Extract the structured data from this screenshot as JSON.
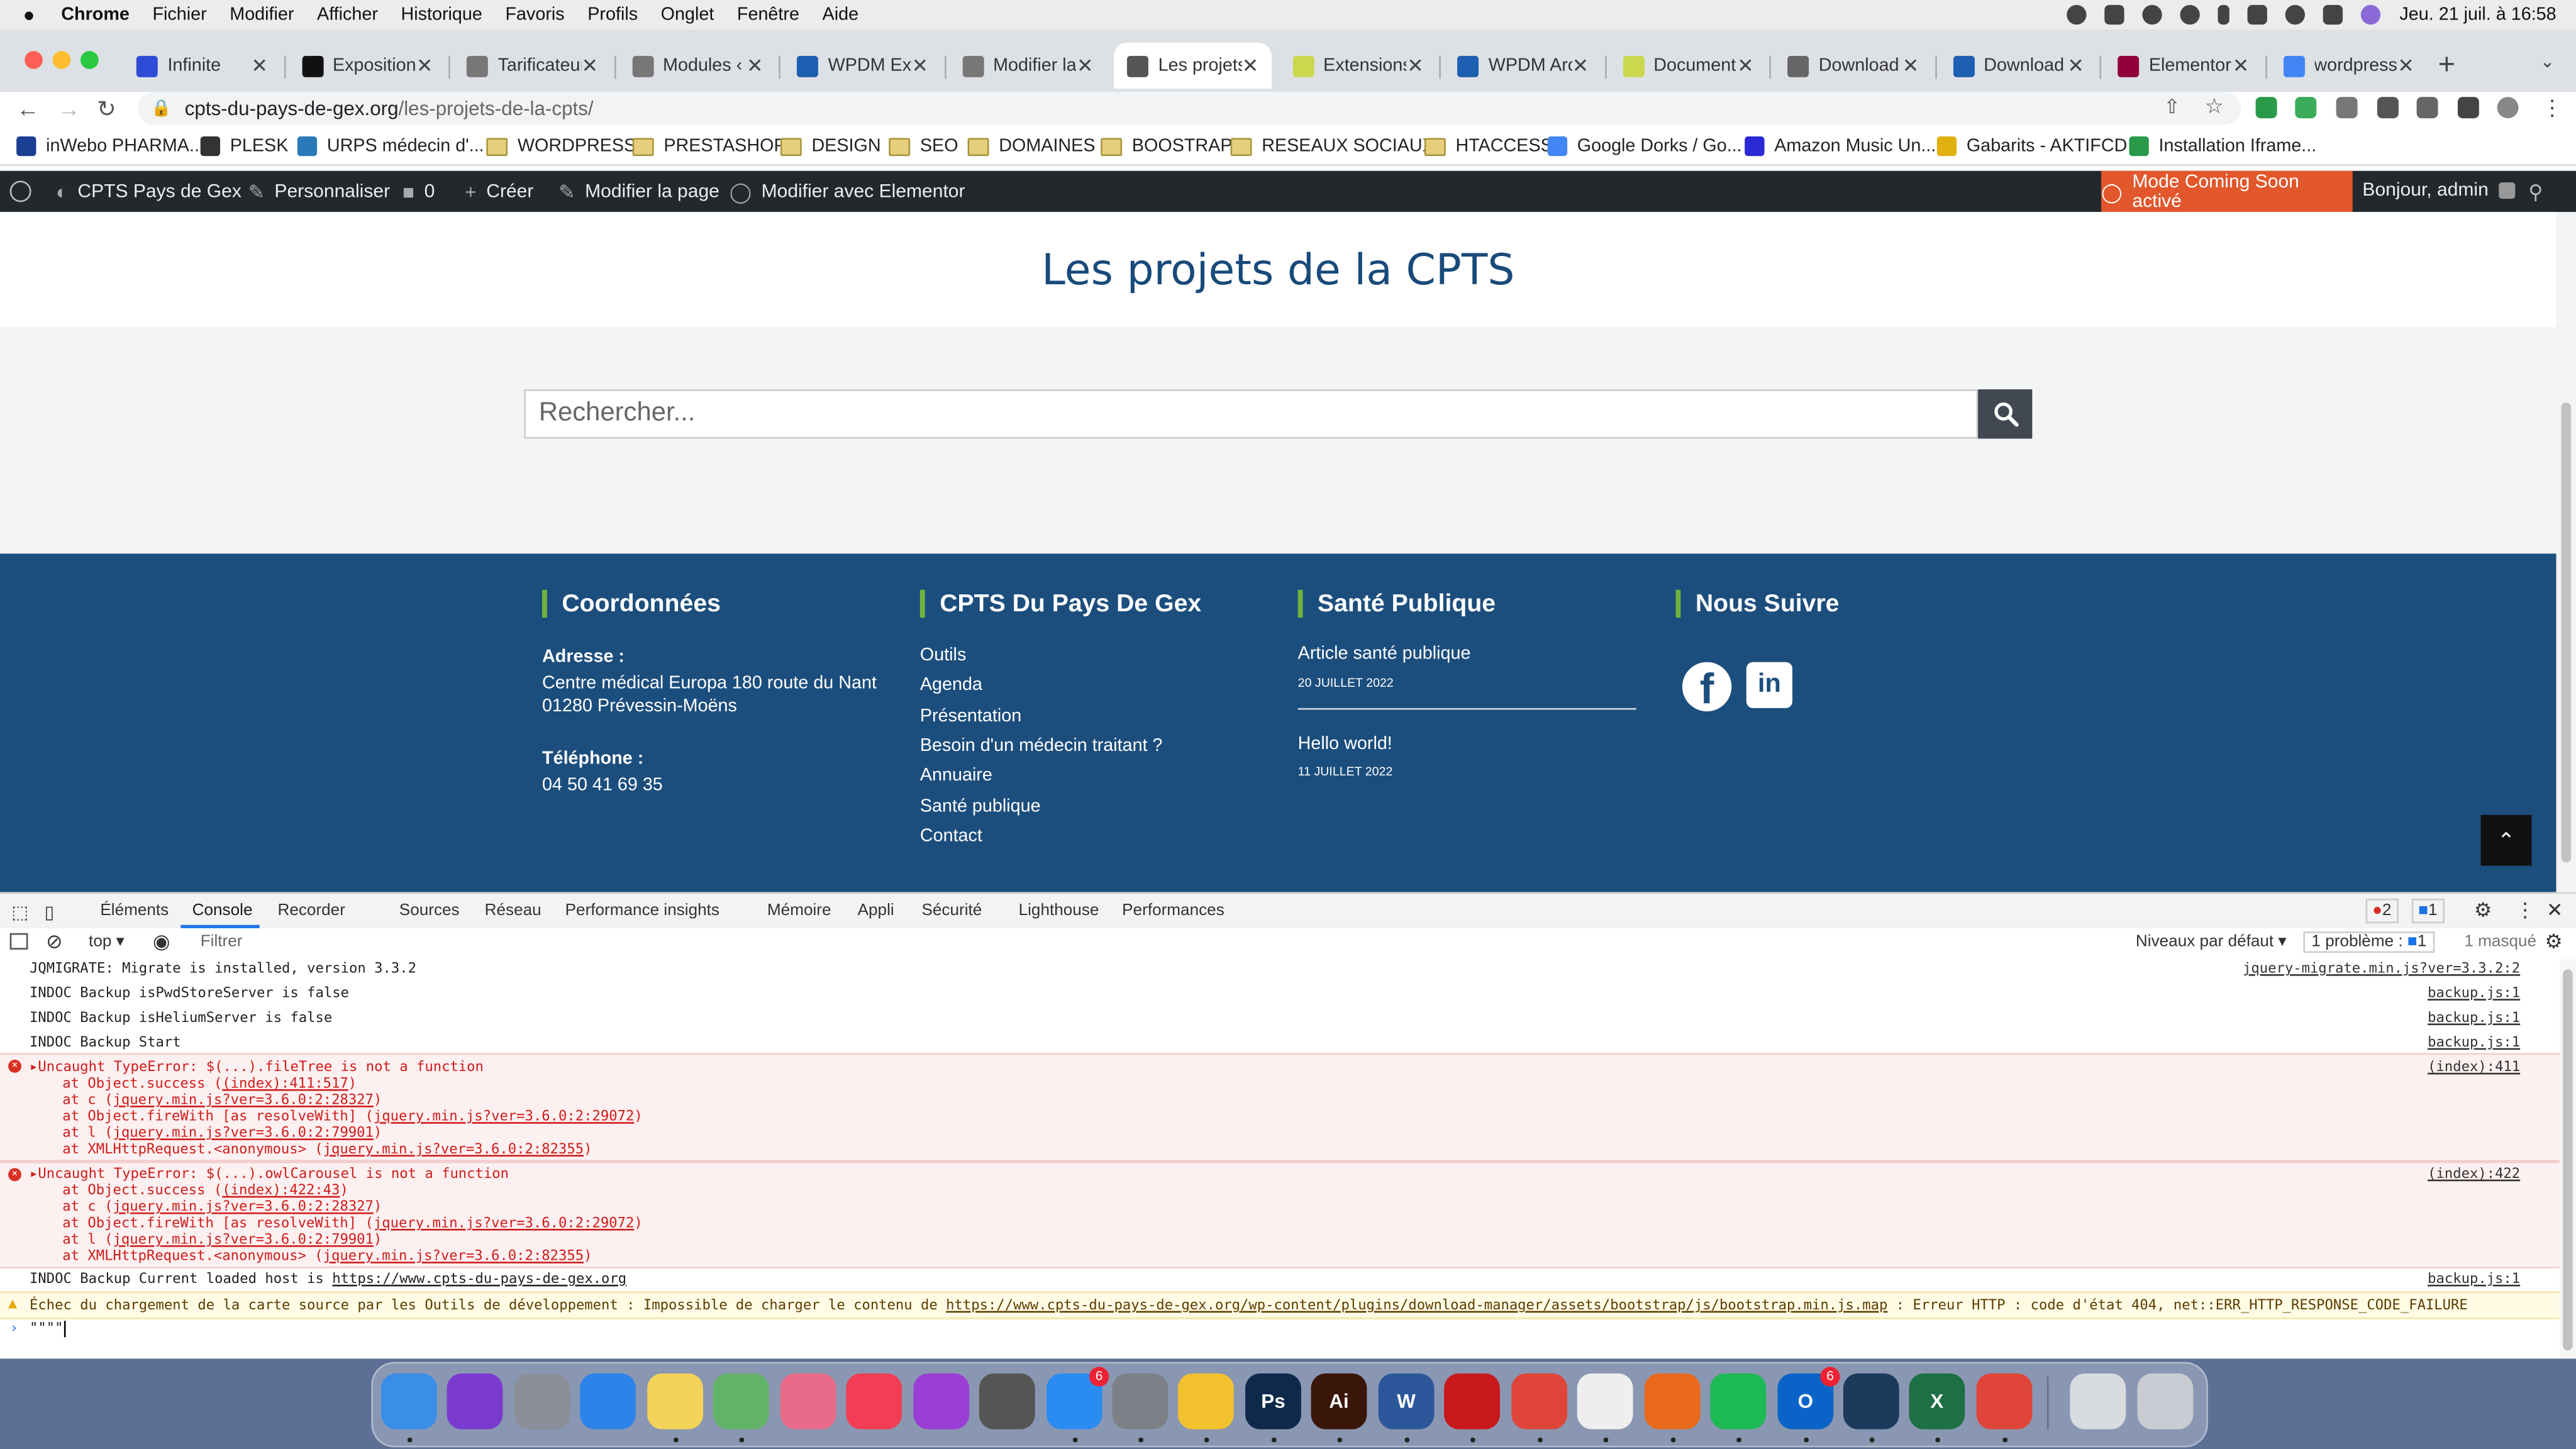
{
  "mac_menu": {
    "items": [
      "Chrome",
      "Fichier",
      "Modifier",
      "Afficher",
      "Historique",
      "Favoris",
      "Profils",
      "Onglet",
      "Fenêtre",
      "Aide"
    ],
    "clock": "Jeu. 21 juil. à 16:58"
  },
  "tabs": [
    {
      "title": "Infinite",
      "color": "#2d4bd6"
    },
    {
      "title": "Exposition",
      "color": "#111111"
    },
    {
      "title": "Tarificateur",
      "color": "#777777"
    },
    {
      "title": "Modules ‹",
      "color": "#777777"
    },
    {
      "title": "WPDM Exte",
      "color": "#1d5fb0"
    },
    {
      "title": "Modifier la",
      "color": "#777777"
    },
    {
      "title": "Les projets",
      "color": "#555555",
      "active": true
    },
    {
      "title": "Extensions",
      "color": "#c9d84c"
    },
    {
      "title": "WPDM Arch",
      "color": "#1d5fb0"
    },
    {
      "title": "Documents",
      "color": "#c9d84c"
    },
    {
      "title": "Download M",
      "color": "#666666"
    },
    {
      "title": "Download M",
      "color": "#1d5fb0"
    },
    {
      "title": "Elementor",
      "color": "#92003b"
    },
    {
      "title": "wordpress",
      "color": "#4285f4"
    }
  ],
  "address": {
    "host": "cpts-du-pays-de-gex.org",
    "path": "/les-projets-de-la-cpts/"
  },
  "bookmarks": [
    {
      "label": "inWebo PHARMA...",
      "type": "site",
      "color": "#1c3f94"
    },
    {
      "label": "PLESK",
      "type": "site",
      "color": "#333333"
    },
    {
      "label": "URPS médecin d'...",
      "type": "site",
      "color": "#2a7ab8"
    },
    {
      "label": "WORDPRESS",
      "type": "folder"
    },
    {
      "label": "PRESTASHOP",
      "type": "folder"
    },
    {
      "label": "DESIGN",
      "type": "folder"
    },
    {
      "label": "SEO",
      "type": "folder"
    },
    {
      "label": "DOMAINES",
      "type": "folder"
    },
    {
      "label": "BOOSTRAP",
      "type": "folder"
    },
    {
      "label": "RESEAUX SOCIAUX",
      "type": "folder"
    },
    {
      "label": "HTACCESS",
      "type": "folder"
    },
    {
      "label": "Google Dorks / Go...",
      "type": "site",
      "color": "#4285f4"
    },
    {
      "label": "Amazon Music Un...",
      "type": "site",
      "color": "#2a2ad4"
    },
    {
      "label": "Gabarits - AKTIFCD",
      "type": "site",
      "color": "#e0b010"
    },
    {
      "label": "Installation Iframe...",
      "type": "site",
      "color": "#2a9a4a"
    }
  ],
  "wp_admin": {
    "site": "CPTS Pays de Gex",
    "customize": "Personnaliser",
    "comments": "0",
    "create": "Créer",
    "edit_page": "Modifier la page",
    "elementor": "Modifier avec Elementor",
    "coming_soon": "Mode Coming Soon activé",
    "greeting": "Bonjour, admin"
  },
  "page": {
    "title": "Les projets de la CPTS",
    "search_placeholder": "Rechercher..."
  },
  "footer": {
    "col1": {
      "heading": "Coordonnées",
      "address_label": "Adresse :",
      "address_line1": "Centre médical Europa 180 route du Nant",
      "address_line2": "01280 Prévessin-Moëns",
      "phone_label": "Téléphone :",
      "phone": "04 50 41 69 35"
    },
    "col2": {
      "heading": "CPTS Du Pays De Gex",
      "links": [
        "Outils",
        "Agenda",
        "Présentation",
        "Besoin d'un médecin traitant ?",
        "Annuaire",
        "Santé publique",
        "Contact"
      ]
    },
    "col3": {
      "heading": "Santé Publique",
      "posts": [
        {
          "title": "Article santé publique",
          "date": "20 JUILLET 2022"
        },
        {
          "title": "Hello world!",
          "date": "11 JUILLET 2022"
        }
      ]
    },
    "col4": {
      "heading": "Nous Suivre",
      "social": [
        "facebook-icon",
        "linkedin-icon"
      ]
    }
  },
  "devtools": {
    "tabs": [
      "Éléments",
      "Console",
      "Recorder",
      "Sources",
      "Réseau",
      "Performance insights",
      "Mémoire",
      "Appli",
      "Sécurité",
      "Lighthouse",
      "Performances"
    ],
    "errors": "2",
    "messages": "1",
    "context": "top",
    "filter_placeholder": "Filtrer",
    "levels": "Niveaux par défaut",
    "problems": "1 problème :",
    "problems_count": "1",
    "hidden": "1 masqué"
  },
  "console": {
    "lines": [
      {
        "text": "JQMIGRATE: Migrate is installed, version 3.3.2",
        "src": "jquery-migrate.min.js?ver=3.3.2:2"
      },
      {
        "text": "INDOC Backup isPwdStoreServer is false",
        "src": "backup.js:1"
      },
      {
        "text": "INDOC Backup isHeliumServer is false",
        "src": "backup.js:1"
      },
      {
        "text": "INDOC Backup Start",
        "src": "backup.js:1"
      }
    ],
    "error1": {
      "msg": "Uncaught TypeError: $(...).fileTree is not a function",
      "src": "(index):411",
      "stack": [
        {
          "pre": "at Object.success (",
          "link": "(index):411:517",
          "post": ")"
        },
        {
          "pre": "at c (",
          "link": "jquery.min.js?ver=3.6.0:2:28327",
          "post": ")"
        },
        {
          "pre": "at Object.fireWith [as resolveWith] (",
          "link": "jquery.min.js?ver=3.6.0:2:29072",
          "post": ")"
        },
        {
          "pre": "at l (",
          "link": "jquery.min.js?ver=3.6.0:2:79901",
          "post": ")"
        },
        {
          "pre": "at XMLHttpRequest.<anonymous> (",
          "link": "jquery.min.js?ver=3.6.0:2:82355",
          "post": ")"
        }
      ]
    },
    "error2": {
      "msg": "Uncaught TypeError: $(...).owlCarousel is not a function",
      "src": "(index):422",
      "stack": [
        {
          "pre": "at Object.success (",
          "link": "(index):422:43",
          "post": ")"
        },
        {
          "pre": "at c (",
          "link": "jquery.min.js?ver=3.6.0:2:28327",
          "post": ")"
        },
        {
          "pre": "at Object.fireWith [as resolveWith] (",
          "link": "jquery.min.js?ver=3.6.0:2:29072",
          "post": ")"
        },
        {
          "pre": "at l (",
          "link": "jquery.min.js?ver=3.6.0:2:79901",
          "post": ")"
        },
        {
          "pre": "at XMLHttpRequest.<anonymous> (",
          "link": "jquery.min.js?ver=3.6.0:2:82355",
          "post": ")"
        }
      ]
    },
    "host_line": {
      "pre": "INDOC Backup Current loaded host is ",
      "link": "https://www.cpts-du-pays-de-gex.org",
      "src": "backup.js:1"
    },
    "warning": {
      "pre": "Échec du chargement de la carte source par les Outils de développement : Impossible de charger le contenu de ",
      "link": "https://www.cpts-du-pays-de-gex.org/wp-content/plugins/download-manager/assets/bootstrap/js/bootstrap.min.js.map",
      "post": " : Erreur HTTP : code d'état 404, net::ERR_HTTP_RESPONSE_CODE_FAILURE"
    },
    "prompt_value": "\"\"\"\""
  },
  "dock": [
    {
      "name": "finder-icon",
      "color": "#3a8ee8",
      "label": ""
    },
    {
      "name": "siri-icon",
      "color": "#7a3ad0",
      "label": ""
    },
    {
      "name": "launchpad-icon",
      "color": "#8a8f99",
      "label": ""
    },
    {
      "name": "safari-icon",
      "color": "#2d84e8",
      "label": ""
    },
    {
      "name": "notes-icon",
      "color": "#f3d35a",
      "label": ""
    },
    {
      "name": "maps-icon",
      "color": "#62b26a",
      "label": ""
    },
    {
      "name": "photos-icon",
      "color": "#e86b8a",
      "label": ""
    },
    {
      "name": "music-icon",
      "color": "#f23d55",
      "label": ""
    },
    {
      "name": "podcasts-icon",
      "color": "#9b3ed6",
      "label": ""
    },
    {
      "name": "calculator-icon",
      "color": "#555555",
      "label": ""
    },
    {
      "name": "app-store-icon",
      "color": "#2a8cf0",
      "label": "",
      "badge": "6"
    },
    {
      "name": "system-preferences-icon",
      "color": "#7d8087",
      "label": ""
    },
    {
      "name": "cyberduck-icon",
      "color": "#f2c22e",
      "label": ""
    },
    {
      "name": "photoshop-icon",
      "color": "#0e2a4a",
      "label": "Ps"
    },
    {
      "name": "illustrator-icon",
      "color": "#3a1608",
      "label": "Ai"
    },
    {
      "name": "word-icon",
      "color": "#2b579a",
      "label": "W"
    },
    {
      "name": "acrobat-icon",
      "color": "#c8191b",
      "label": ""
    },
    {
      "name": "chrome-icon",
      "color": "#e0453a",
      "label": ""
    },
    {
      "name": "textedit-icon",
      "color": "#eeeeee",
      "label": ""
    },
    {
      "name": "firefox-icon",
      "color": "#e8681c",
      "label": ""
    },
    {
      "name": "spotify-icon",
      "color": "#1db954",
      "label": ""
    },
    {
      "name": "outlook-icon",
      "color": "#0a64c8",
      "label": "O",
      "badge": "6"
    },
    {
      "name": "bbedit-icon",
      "color": "#1b3a5c",
      "label": ""
    },
    {
      "name": "excel-icon",
      "color": "#1d7044",
      "label": "X"
    },
    {
      "name": "anydesk-icon",
      "color": "#e0453a",
      "label": ""
    },
    {
      "name": "downloads-stack-icon",
      "color": "#d8dbe0",
      "label": ""
    },
    {
      "name": "trash-icon",
      "color": "#c9ccd2",
      "label": ""
    }
  ]
}
